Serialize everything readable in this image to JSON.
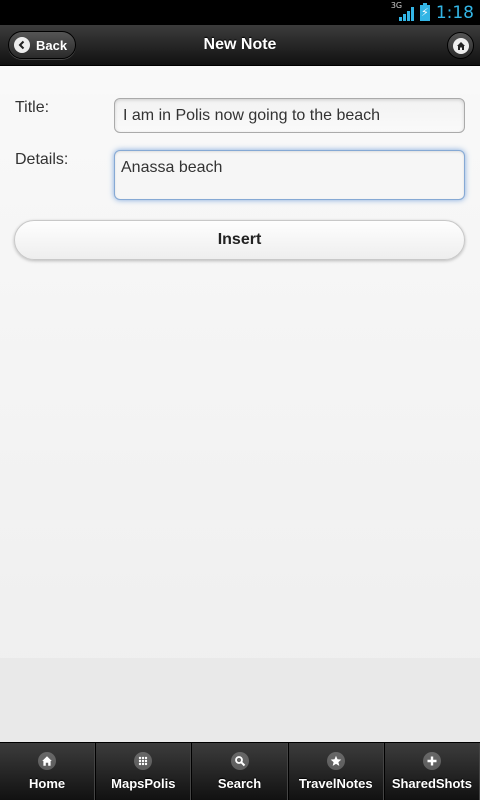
{
  "status_bar": {
    "network_type": "3G",
    "time": "1:18"
  },
  "header": {
    "title": "New Note",
    "back_label": "Back"
  },
  "form": {
    "title_label": "Title:",
    "title_value": "I am in Polis now going to the beach",
    "details_label": "Details:",
    "details_value": "Anassa beach",
    "insert_label": "Insert"
  },
  "nav": {
    "items": [
      {
        "label": "Home",
        "icon": "home-icon"
      },
      {
        "label": "MapsPolis",
        "icon": "grid-icon"
      },
      {
        "label": "Search",
        "icon": "search-icon"
      },
      {
        "label": "TravelNotes",
        "icon": "star-icon"
      },
      {
        "label": "SharedShots",
        "icon": "plus-icon"
      }
    ]
  },
  "colors": {
    "accent": "#33b5e5",
    "focus_glow": "#7ea7dd"
  }
}
